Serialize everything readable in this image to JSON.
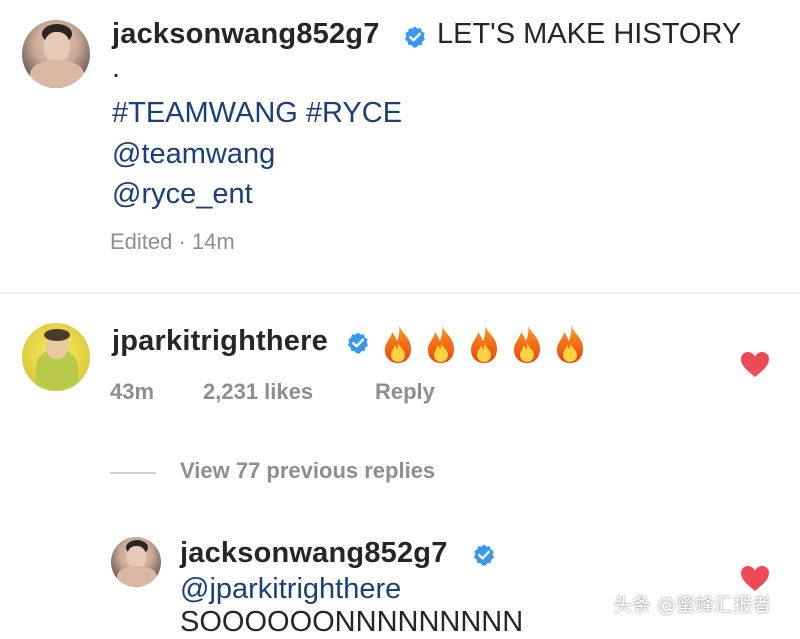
{
  "post": {
    "username": "jacksonwang852g7",
    "caption": "LET'S MAKE HISTORY",
    "dot": ".",
    "hashtags": "#TEAMWANG #RYCE",
    "mention_1": "@teamwang",
    "mention_2": "@ryce_ent",
    "edited": "Edited · 14m"
  },
  "comment": {
    "username": "jparkitrighthere",
    "emoji_text": "🔥🔥🔥🔥🔥",
    "time": "43m",
    "likes": "2,231 likes",
    "reply_label": "Reply",
    "liked": true
  },
  "view_replies": "View 77 previous replies",
  "reply": {
    "username": "jacksonwang852g7",
    "mention": "@jparkitrighthere",
    "text": "SOOOOOONNNNNNNNN",
    "liked": true
  },
  "watermark": "头条 @蜜蜂汇报者",
  "colors": {
    "verified": "#3897f0",
    "heart": "#ed4956",
    "link": "#1b3f7a",
    "muted": "#8e8e8e"
  },
  "icons": {
    "verified": "verified-badge-icon",
    "heart": "heart-icon",
    "fire": "fire-emoji-icon"
  }
}
